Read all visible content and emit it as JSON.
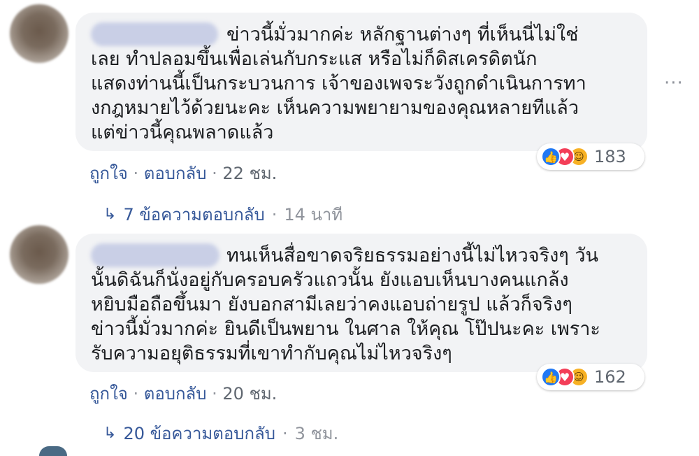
{
  "comments": [
    {
      "text": "ข่าวนี้มั่วมากค่ะ หลักฐานต่างๆ ที่เห็นนี่ไม่ใช่\nเลย ทำปลอมขึ้นเพื่อเล่นกับกระแส หรือไม่ก็ดิสเครดิตนัก\nแสดงท่านนี้เป็นกระบวนการ เจ้าของเพจระวังถูกดำเนินการทา\nงกฎหมายไว้ด้วยนะคะ เห็นความพยายามของคุณหลายทีแล้ว\nแต่ข่าวนี้คุณพลาดแล้ว",
      "reaction_count": "183",
      "like_label": "ถูกใจ",
      "reply_label": "ตอบกลับ",
      "time": "22 ชม.",
      "replies_label": "7 ข้อความตอบกลับ",
      "replies_time": "14 นาที"
    },
    {
      "text": "ทนเห็นสื่อขาดจริยธรรมอย่างนี้ไม่ไหวจริงๆ วัน\nนั้นดิฉันก็นั่งอยู่กับครอบครัวแถวนั้น ยังแอบเห็นบางคนแกล้ง\nหยิบมือถือขึ้นมา ยังบอกสามีเลยว่าคงแอบถ่ายรูป แล้วก็จริงๆ\nข่าวนี้มั่วมากค่ะ ยินดีเป็นพยาน ในศาล ให้คุณ โป๊ปนะคะ เพราะ\nรับความอยุติธรรมที่เขาทำกับคุณไม่ไหวจริงๆ",
      "reaction_count": "162",
      "like_label": "ถูกใจ",
      "reply_label": "ตอบกลับ",
      "time": "20 ชม.",
      "replies_label": "20 ข้อความตอบกลับ",
      "replies_time": "3 ชม."
    }
  ],
  "icons": {
    "like": "thumbs-up-icon",
    "love": "heart-icon",
    "haha": "laughing-face-icon",
    "reply_arrow": "reply-arrow-icon",
    "more": "more-options-icon"
  },
  "colors": {
    "bubble": "#f2f3f5",
    "link": "#365899",
    "meta": "#606770",
    "like": "#2078f4",
    "love": "#f33e58",
    "haha": "#f7b125"
  },
  "separator": "·",
  "more_glyph": "···"
}
